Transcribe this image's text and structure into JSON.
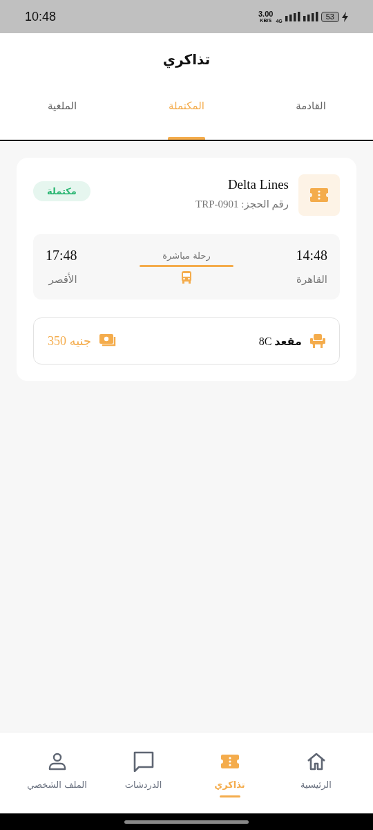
{
  "status_bar": {
    "time": "10:48",
    "net_speed": "3.00",
    "net_unit": "KB/S",
    "network": "4G",
    "battery": "53"
  },
  "header": {
    "title": "تذاكري"
  },
  "tabs": [
    {
      "label": "القادمة",
      "selected": false
    },
    {
      "label": "المكتملة",
      "selected": true
    },
    {
      "label": "الملغية",
      "selected": false
    }
  ],
  "tickets": [
    {
      "operator": "Delta Lines",
      "booking": "رقم الحجز: TRP-0901",
      "status": "مكتملة",
      "departure": {
        "time": "14:48",
        "city": "القاهرة"
      },
      "trip_type": "رحلة مباشرة",
      "arrival": {
        "time": "17:48",
        "city": "الأقصر"
      },
      "seat": "**مقعد** 8C",
      "price": "جنيه 350"
    }
  ],
  "bottom_nav": [
    {
      "label": "الرئيسية",
      "kind": "home",
      "selected": false
    },
    {
      "label": "تذاكري",
      "kind": "ticket",
      "selected": true
    },
    {
      "label": "الدردشات",
      "kind": "chat",
      "selected": false
    },
    {
      "label": "الملف الشخصي",
      "kind": "person",
      "selected": false
    }
  ]
}
